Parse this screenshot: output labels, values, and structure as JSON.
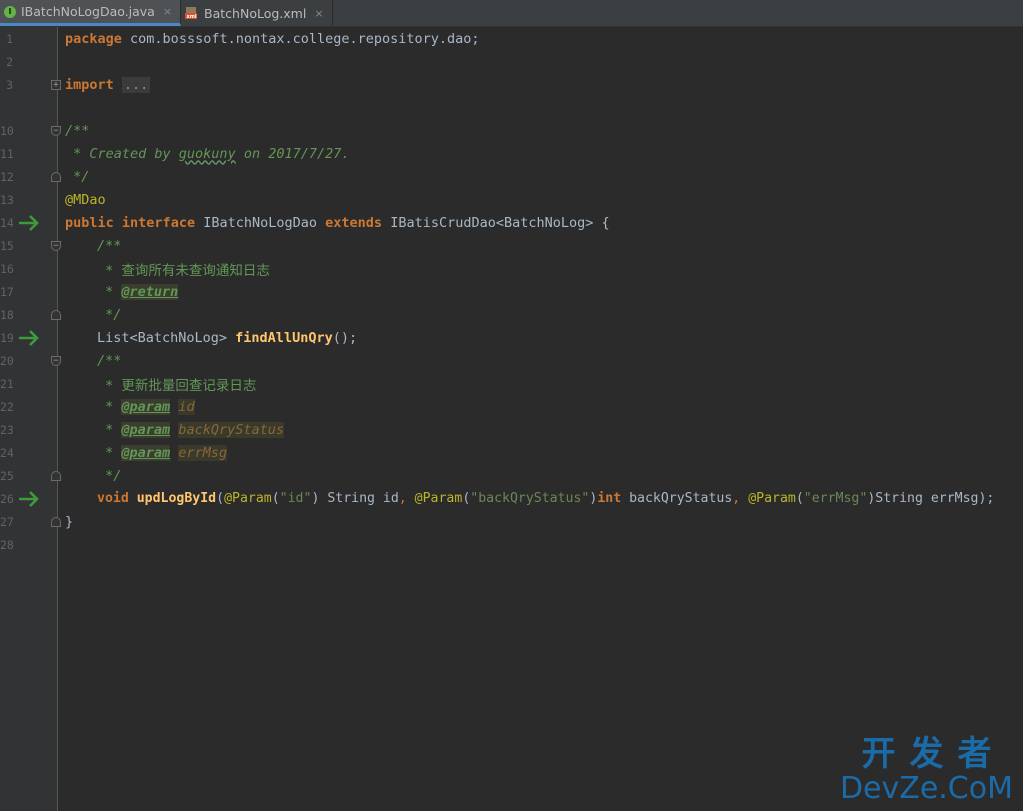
{
  "tabs": [
    {
      "label": "IBatchNoLogDao.java",
      "icon": "java-interface-icon",
      "active": true
    },
    {
      "label": "BatchNoLog.xml",
      "icon": "xml-file-icon",
      "active": false
    }
  ],
  "colors": {
    "keyword": "#cc7832",
    "annotation": "#bbb529",
    "method": "#ffc66d",
    "string": "#6a8759",
    "comment": "#629755",
    "text": "#a9b7c6",
    "run_arrow": "#3d9a3f",
    "background": "#2b2b2b",
    "gutter": "#313335"
  },
  "editor": {
    "line_numbers": [
      "1",
      "2",
      "3",
      "10",
      "11",
      "12",
      "13",
      "14",
      "15",
      "16",
      "17",
      "18",
      "19",
      "20",
      "21",
      "22",
      "23",
      "24",
      "25",
      "26",
      "27",
      "28"
    ],
    "lines": {
      "l1": {
        "kw": "package",
        "rest": "com.bosssoft.nontax.college.repository.dao;"
      },
      "l3": {
        "kw": "import",
        "folded": "..."
      },
      "l10": {
        "doc": "/**"
      },
      "l11": {
        "pre": " * Created by ",
        "author": "guokuny",
        "post": " on 2017/7/27."
      },
      "l12": {
        "doc": " */"
      },
      "l13": {
        "ann": "@MDao"
      },
      "l14": {
        "kw1": "public",
        "kw2": "interface",
        "name": "IBatchNoLogDao",
        "kw3": "extends",
        "rest": "IBatisCrudDao<BatchNoLog> {"
      },
      "l15": {
        "doc": "/**"
      },
      "l16": {
        "doc": " * 查询所有未查询通知日志"
      },
      "l17": {
        "star": " * ",
        "tag": "@return"
      },
      "l18": {
        "doc": " */"
      },
      "l19": {
        "type": "List<BatchNoLog> ",
        "method": "findAllUnQry",
        "rest": "();"
      },
      "l20": {
        "doc": "/**"
      },
      "l21": {
        "doc": " * 更新批量回查记录日志"
      },
      "l22": {
        "star": " * ",
        "tag": "@param",
        "val": "id"
      },
      "l23": {
        "star": " * ",
        "tag": "@param",
        "val": "backQryStatus"
      },
      "l24": {
        "star": " * ",
        "tag": "@param",
        "val": "errMsg"
      },
      "l25": {
        "doc": " */"
      },
      "l26": {
        "kw": "void",
        "method": "updLogById",
        "p1": "(",
        "ann1": "@Param",
        "s1": "\"id\"",
        "t1": ") String id",
        "c1": ", ",
        "ann2": "@Param",
        "s2": "\"backQryStatus\"",
        "t2a": ")",
        "kw2": "int",
        "t2b": " backQryStatus",
        "c2": ", ",
        "ann3": "@Param",
        "s3": "\"errMsg\"",
        "t3": ")String errMsg);"
      },
      "l27": {
        "text": "}"
      }
    }
  },
  "watermark": {
    "line1": "开发者",
    "line2": "DevZe.CoM"
  }
}
